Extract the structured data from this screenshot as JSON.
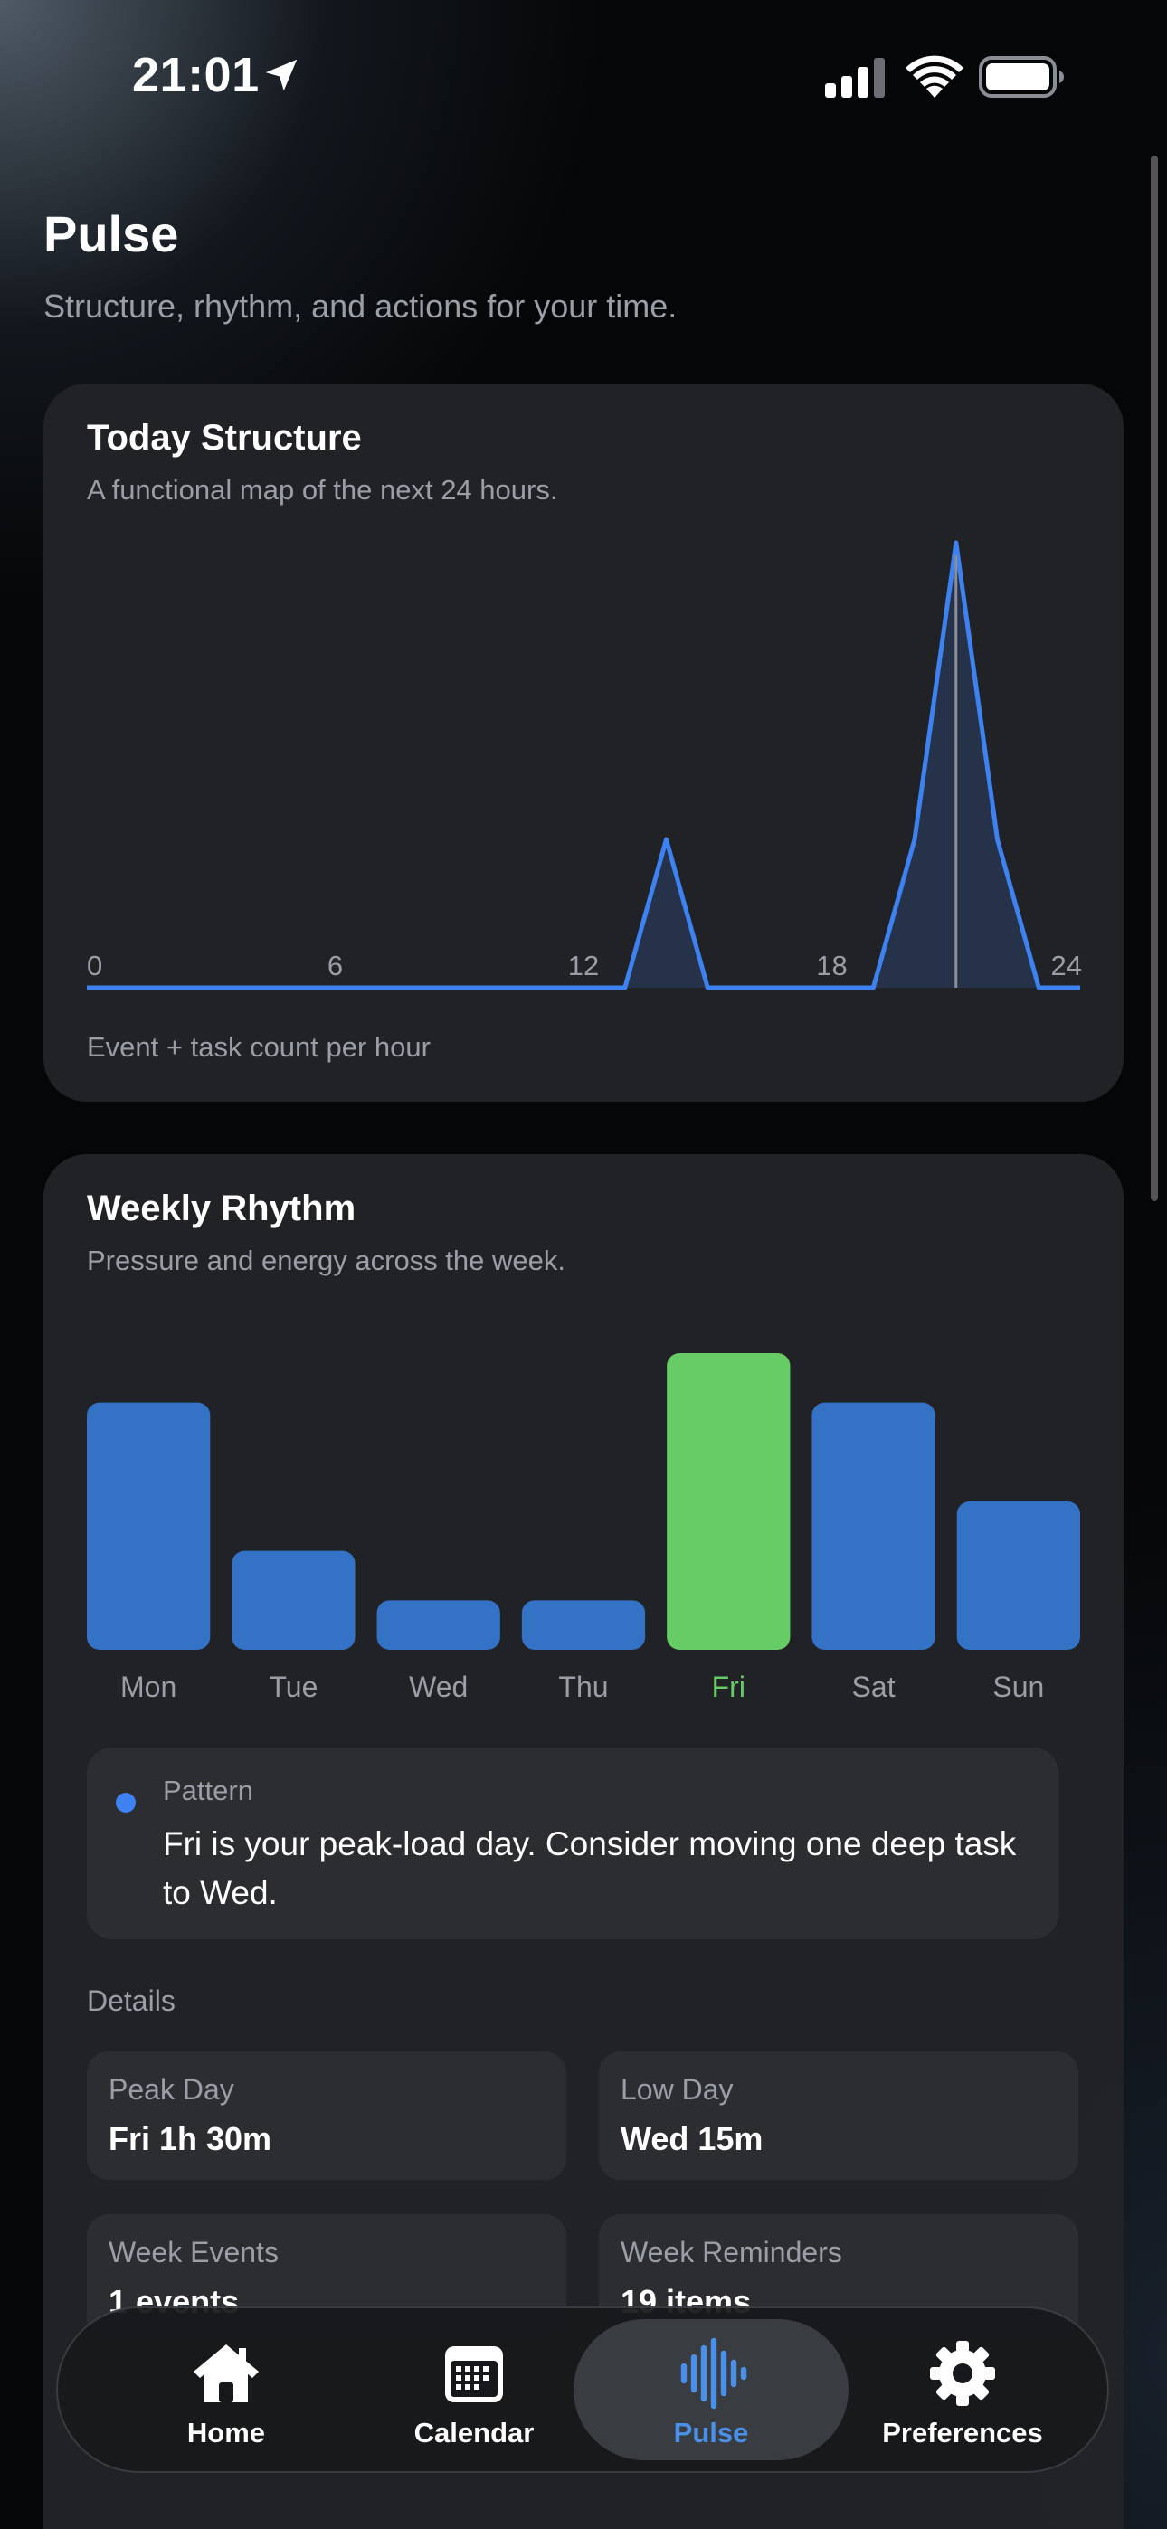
{
  "status_bar": {
    "time": "21:01"
  },
  "header": {
    "title": "Pulse",
    "subtitle": "Structure, rhythm, and actions for your time."
  },
  "today_structure": {
    "title": "Today Structure",
    "subtitle": "A functional map of the next 24 hours.",
    "footer": "Event + task count per hour"
  },
  "weekly_rhythm": {
    "title": "Weekly Rhythm",
    "subtitle": "Pressure and energy across the week.",
    "pattern": {
      "label": "Pattern",
      "text": "Fri is your peak-load day. Consider moving one deep task to Wed."
    },
    "details_label": "Details",
    "stats": [
      {
        "label": "Peak Day",
        "value": "Fri 1h 30m"
      },
      {
        "label": "Low Day",
        "value": "Wed 15m"
      },
      {
        "label": "Week Events",
        "value": "1 events"
      },
      {
        "label": "Week Reminders",
        "value": "19 items"
      }
    ]
  },
  "colors": {
    "accent_blue": "#3d82f0",
    "bar_blue": "#3472c5",
    "peak_green": "#66cc66"
  },
  "chart_data": [
    {
      "type": "area",
      "x": [
        0,
        13,
        14,
        15,
        19,
        20,
        21,
        22,
        23,
        24
      ],
      "values": [
        0,
        0,
        1,
        0,
        0,
        1,
        3,
        1,
        0,
        0
      ],
      "x_ticks": [
        "0",
        "6",
        "12",
        "18",
        "24"
      ],
      "xlim": [
        0,
        24
      ],
      "current_time_marker": 21,
      "grid": false
    },
    {
      "type": "bar",
      "categories": [
        "Mon",
        "Tue",
        "Wed",
        "Thu",
        "Fri",
        "Sat",
        "Sun"
      ],
      "values": [
        5,
        2,
        1,
        1,
        6,
        5,
        3
      ],
      "highlight": "Fri",
      "ylim": [
        0,
        6
      ]
    }
  ],
  "tab_bar": {
    "tabs": [
      {
        "label": "Home",
        "icon": "house-icon"
      },
      {
        "label": "Calendar",
        "icon": "calendar-icon"
      },
      {
        "label": "Pulse",
        "icon": "waveform-icon",
        "active": true
      },
      {
        "label": "Preferences",
        "icon": "gear-icon"
      }
    ]
  }
}
